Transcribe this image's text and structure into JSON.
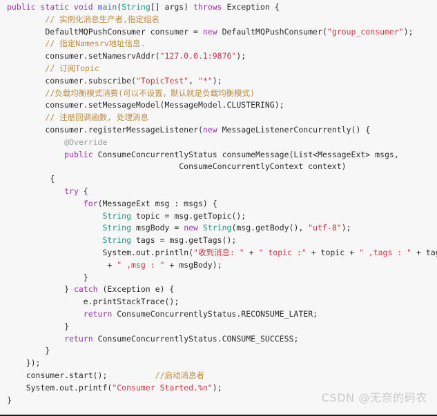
{
  "document": {
    "kind": "java-code-listing",
    "language": "Java",
    "background_color": "#f7f7f7",
    "colors": {
      "keyword": "#9b30b0",
      "method_name": "#3b6fd4",
      "type": "#1a9a82",
      "string": "#d0333f",
      "comment": "#c08a3e",
      "annotation": "#9a9a9a",
      "plain": "#2b2b2b",
      "watermark": "#c9c9c9"
    }
  },
  "watermark": {
    "text": "CSDN @无奈的码农"
  },
  "code": {
    "lines": [
      [
        {
          "t": "public static void ",
          "c": "kw"
        },
        {
          "t": "main",
          "c": "fn"
        },
        {
          "t": "(",
          "c": "pl"
        },
        {
          "t": "String",
          "c": "typ"
        },
        {
          "t": "[] args) ",
          "c": "pl"
        },
        {
          "t": "throws ",
          "c": "kw"
        },
        {
          "t": "Exception {",
          "c": "pl"
        }
      ],
      [
        {
          "t": "        ",
          "c": "pl"
        },
        {
          "t": "// 实例化消息生产者,指定组名",
          "c": "cmt"
        }
      ],
      [
        {
          "t": "        DefaultMQPushConsumer consumer = ",
          "c": "pl"
        },
        {
          "t": "new",
          "c": "kw"
        },
        {
          "t": " DefaultMQPushConsumer(",
          "c": "pl"
        },
        {
          "t": "\"group_consumer\"",
          "c": "str"
        },
        {
          "t": ");",
          "c": "pl"
        }
      ],
      [
        {
          "t": "        ",
          "c": "pl"
        },
        {
          "t": "// 指定Namesrv地址信息.",
          "c": "cmt"
        }
      ],
      [
        {
          "t": "        consumer.setNamesrvAddr(",
          "c": "pl"
        },
        {
          "t": "\"127.0.0.1:9876\"",
          "c": "str"
        },
        {
          "t": ");",
          "c": "pl"
        }
      ],
      [
        {
          "t": "        ",
          "c": "pl"
        },
        {
          "t": "// 订阅Topic",
          "c": "cmt"
        }
      ],
      [
        {
          "t": "        consumer.subscribe(",
          "c": "pl"
        },
        {
          "t": "\"TopicTest\"",
          "c": "str"
        },
        {
          "t": ", ",
          "c": "pl"
        },
        {
          "t": "\"*\"",
          "c": "str"
        },
        {
          "t": ");",
          "c": "pl"
        }
      ],
      [
        {
          "t": "        ",
          "c": "pl"
        },
        {
          "t": "//负载均衡模式消费(可以不设置，默认就是负载均衡模式)",
          "c": "cmt"
        }
      ],
      [
        {
          "t": "        consumer.setMessageModel(MessageModel.CLUSTERING);",
          "c": "pl"
        }
      ],
      [
        {
          "t": "        ",
          "c": "pl"
        },
        {
          "t": "// 注册回调函数, 处理消息",
          "c": "cmt"
        }
      ],
      [
        {
          "t": "        consumer.registerMessageListener(",
          "c": "pl"
        },
        {
          "t": "new",
          "c": "kw"
        },
        {
          "t": " MessageListenerConcurrently() {",
          "c": "pl"
        }
      ],
      [
        {
          "t": "            ",
          "c": "pl"
        },
        {
          "t": "@Override",
          "c": "ann"
        }
      ],
      [
        {
          "t": "            ",
          "c": "pl"
        },
        {
          "t": "public",
          "c": "kw"
        },
        {
          "t": " ConsumeConcurrentlyStatus consumeMessage(List<MessageExt> msgs,",
          "c": "pl"
        }
      ],
      [
        {
          "t": "                                    ConsumeConcurrentlyContext context)",
          "c": "pl"
        }
      ],
      [
        {
          "t": "         {",
          "c": "pl"
        }
      ],
      [
        {
          "t": "            ",
          "c": "pl"
        },
        {
          "t": "try",
          "c": "kw"
        },
        {
          "t": " {",
          "c": "pl"
        }
      ],
      [
        {
          "t": "                ",
          "c": "pl"
        },
        {
          "t": "for",
          "c": "kw"
        },
        {
          "t": "(MessageExt msg : msgs) {",
          "c": "pl"
        }
      ],
      [
        {
          "t": "                    ",
          "c": "pl"
        },
        {
          "t": "String",
          "c": "typ"
        },
        {
          "t": " topic = msg.getTopic();",
          "c": "pl"
        }
      ],
      [
        {
          "t": "                    ",
          "c": "pl"
        },
        {
          "t": "String",
          "c": "typ"
        },
        {
          "t": " msgBody = ",
          "c": "pl"
        },
        {
          "t": "new",
          "c": "kw"
        },
        {
          "t": " ",
          "c": "pl"
        },
        {
          "t": "String",
          "c": "typ"
        },
        {
          "t": "(msg.getBody(), ",
          "c": "pl"
        },
        {
          "t": "\"utf-8\"",
          "c": "str"
        },
        {
          "t": ");",
          "c": "pl"
        }
      ],
      [
        {
          "t": "                    ",
          "c": "pl"
        },
        {
          "t": "String",
          "c": "typ"
        },
        {
          "t": " tags = msg.getTags();",
          "c": "pl"
        }
      ],
      [
        {
          "t": "                    System.out.println(",
          "c": "pl"
        },
        {
          "t": "\"收到消息: \"",
          "c": "str"
        },
        {
          "t": " + ",
          "c": "pl"
        },
        {
          "t": "\" topic :\"",
          "c": "str"
        },
        {
          "t": " + topic + ",
          "c": "pl"
        },
        {
          "t": "\" ,tags : \"",
          "c": "str"
        },
        {
          "t": " + tags",
          "c": "pl"
        }
      ],
      [
        {
          "t": "                     + ",
          "c": "pl"
        },
        {
          "t": "\" ,msg : \"",
          "c": "str"
        },
        {
          "t": " + msgBody);",
          "c": "pl"
        }
      ],
      [
        {
          "t": "                }",
          "c": "pl"
        }
      ],
      [
        {
          "t": "            } ",
          "c": "pl"
        },
        {
          "t": "catch",
          "c": "kw"
        },
        {
          "t": " (Exception e) {",
          "c": "pl"
        }
      ],
      [
        {
          "t": "                e.printStackTrace();",
          "c": "pl"
        }
      ],
      [
        {
          "t": "                ",
          "c": "pl"
        },
        {
          "t": "return",
          "c": "kw"
        },
        {
          "t": " ConsumeConcurrentlyStatus.RECONSUME_LATER;",
          "c": "pl"
        }
      ],
      [
        {
          "t": "            }",
          "c": "pl"
        }
      ],
      [
        {
          "t": "            ",
          "c": "pl"
        },
        {
          "t": "return",
          "c": "kw"
        },
        {
          "t": " ConsumeConcurrentlyStatus.CONSUME_SUCCESS;",
          "c": "pl"
        }
      ],
      [
        {
          "t": "        }",
          "c": "pl"
        }
      ],
      [
        {
          "t": "    });",
          "c": "pl"
        }
      ],
      [
        {
          "t": "    consumer.start();          ",
          "c": "pl"
        },
        {
          "t": "//启动消息者",
          "c": "cmt"
        }
      ],
      [
        {
          "t": "    System.out.printf(",
          "c": "pl"
        },
        {
          "t": "\"Consumer Started.%n\"",
          "c": "str"
        },
        {
          "t": ");",
          "c": "pl"
        }
      ],
      [
        {
          "t": "}",
          "c": "pl"
        }
      ]
    ]
  }
}
